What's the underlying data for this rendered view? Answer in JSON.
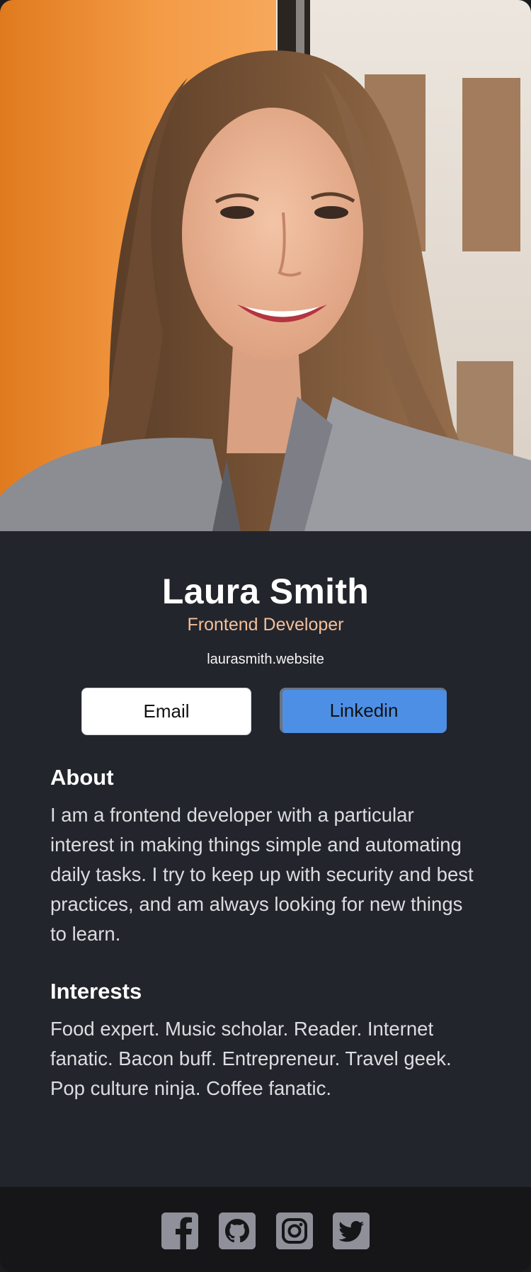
{
  "profile": {
    "name": "Laura Smith",
    "title": "Frontend Developer",
    "website": "laurasmith.website"
  },
  "buttons": {
    "email_label": "Email",
    "linkedin_label": "Linkedin"
  },
  "about": {
    "heading": "About",
    "text": "I am a frontend developer with a particular interest in making things simple and automating daily tasks. I try to keep up with security and best practices, and am always looking for new things to learn."
  },
  "interests": {
    "heading": "Interests",
    "text": "Food expert. Music scholar. Reader. Internet fanatic. Bacon buff. Entrepreneur. Travel geek. Pop culture ninja. Coffee fanatic."
  },
  "footer": {
    "icons": [
      "facebook-icon",
      "github-icon",
      "instagram-icon",
      "twitter-icon"
    ]
  },
  "colors": {
    "card_background": "#23252c",
    "footer_background": "#161619",
    "title_accent": "#f3bf99",
    "linkedin_button": "#4e8fe6",
    "social_icon": "#90909a"
  }
}
